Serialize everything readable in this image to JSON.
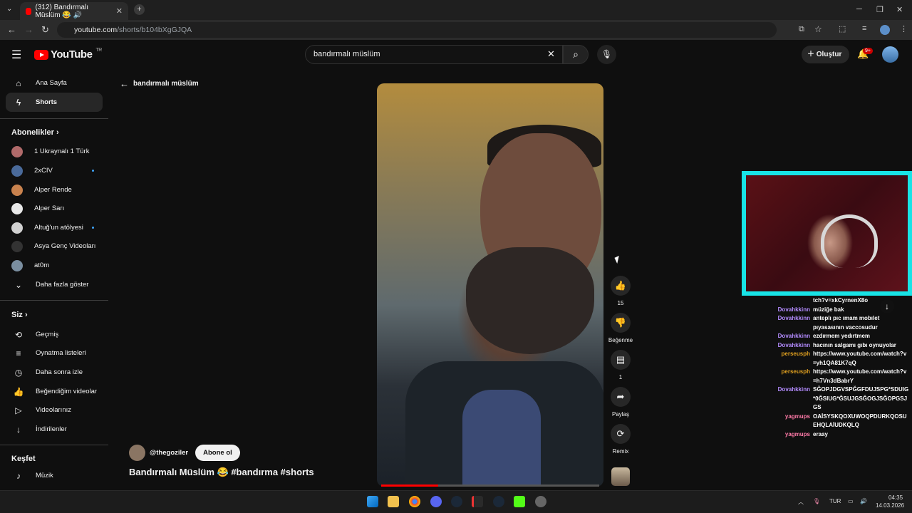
{
  "browser": {
    "tab_title": "(312) Bandırmalı Müslüm 😂 🔊",
    "url_host": "youtube.com",
    "url_path": "/shorts/b104bXgGJQA",
    "tab_close": "✕",
    "new_tab": "+"
  },
  "header": {
    "logo_text": "YouTube",
    "region": "TR",
    "search_value": "bandırmalı müslüm",
    "create_label": "Oluştur",
    "notification_count": "9+"
  },
  "sidebar": {
    "main": [
      {
        "label": "Ana Sayfa",
        "icon": "home-icon"
      },
      {
        "label": "Shorts",
        "icon": "shorts-icon"
      }
    ],
    "subs_title": "Abonelikler",
    "subs": [
      {
        "label": "1 Ukraynalı 1 Türk",
        "color": "#b06a6a"
      },
      {
        "label": "2xCIV",
        "color": "#4a6a9a"
      },
      {
        "label": "Alper Rende",
        "color": "#c9824e"
      },
      {
        "label": "Alper Sarı",
        "color": "#e8e8e8"
      },
      {
        "label": "Altuğ'un atölyesi",
        "color": "#d0d0d0"
      },
      {
        "label": "Asya Genç Videoları",
        "color": "#333333"
      },
      {
        "label": "at0m",
        "color": "#7a8ea0"
      }
    ],
    "show_more": "Daha fazla göster",
    "you_title": "Siz",
    "you": [
      {
        "label": "Geçmiş"
      },
      {
        "label": "Oynatma listeleri"
      },
      {
        "label": "Daha sonra izle"
      },
      {
        "label": "Beğendiğim videolar"
      },
      {
        "label": "Videolarınız"
      },
      {
        "label": "İndirilenler"
      }
    ],
    "explore_title": "Keşfet",
    "explore": [
      {
        "label": "Müzik"
      }
    ]
  },
  "shorts": {
    "back_label": "bandırmalı müslüm",
    "like_count": "15",
    "dislike_label": "Beğenme",
    "comment_count": "1",
    "share_label": "Paylaş",
    "remix_label": "Remix",
    "channel": "@thegoziler",
    "subscribe_label": "Abone ol",
    "title": "Bandırmalı Müslüm 😂 #bandırma #shorts",
    "progress": 0.26
  },
  "chat": [
    {
      "name": "",
      "msg": "tch?v=xkCyrnenX8o",
      "color": "#ffffff"
    },
    {
      "name": "Dovahkkinn",
      "msg": "müziğe bak",
      "color": "#b48cff"
    },
    {
      "name": "Dovahkkinn",
      "msg": "anteplı pıc ımam mobılet pıyasasının vaccosudur",
      "color": "#b48cff"
    },
    {
      "name": "Dovahkkinn",
      "msg": "ezdırmem yedırtmem",
      "color": "#b48cff"
    },
    {
      "name": "Dovahkkinn",
      "msg": "hacının salgamı gıbı oynuyolar",
      "color": "#b48cff"
    },
    {
      "name": "perseusph",
      "msg": "https://www.youtube.com/watch?v=yh1QA81K7qQ",
      "color": "#e0a020"
    },
    {
      "name": "perseusph",
      "msg": "https://www.youtube.com/watch?v=h7Vn3dBabrY",
      "color": "#e0a020"
    },
    {
      "name": "Dovahkkinn",
      "msg": "SĞOPJDGVSPĞGFDUJSPG*SDUIG*0ĞSIUG*ĞSUJGSĞOGJSĞOPGSJGS",
      "color": "#b48cff"
    },
    {
      "name": "yagmups",
      "msg": "OAİSYSKQOXUWOQPDURKQOSUEHQLAİUDKQLQ",
      "color": "#ff7aa8"
    },
    {
      "name": "yagmups",
      "msg": "eraay",
      "color": "#ff7aa8"
    }
  ],
  "taskbar": {
    "lang": "TUR",
    "time": "04:35",
    "date": "14.03.2026"
  }
}
